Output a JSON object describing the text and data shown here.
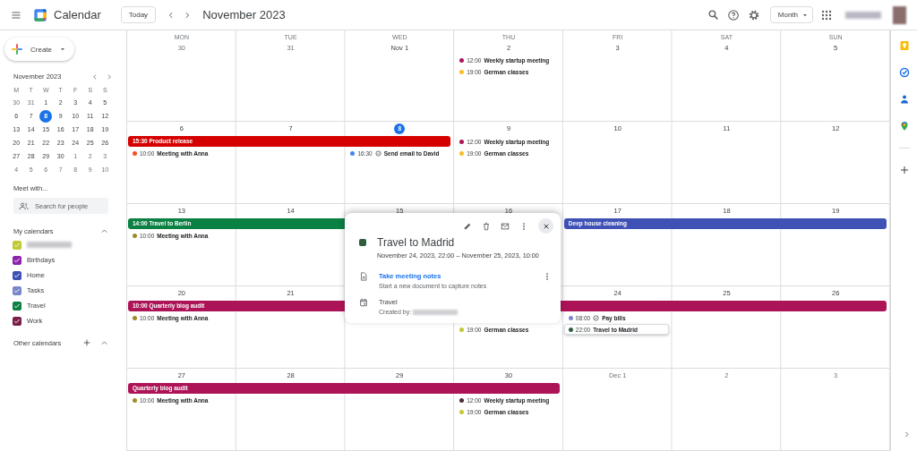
{
  "header": {
    "app_name": "Calendar",
    "today": "Today",
    "period": "November 2023",
    "view": "Month"
  },
  "sidebar": {
    "create": "Create",
    "mini_calendar": {
      "title": "November 2023",
      "weekdays": [
        "M",
        "T",
        "W",
        "T",
        "F",
        "S",
        "S"
      ],
      "weeks": [
        [
          {
            "day": "30",
            "in_month": false,
            "selected": false
          },
          {
            "day": "31",
            "in_month": false,
            "selected": false
          },
          {
            "day": "1",
            "in_month": true,
            "selected": false
          },
          {
            "day": "2",
            "in_month": true,
            "selected": false
          },
          {
            "day": "3",
            "in_month": true,
            "selected": false
          },
          {
            "day": "4",
            "in_month": true,
            "selected": false
          },
          {
            "day": "5",
            "in_month": true,
            "selected": false
          }
        ],
        [
          {
            "day": "6",
            "in_month": true,
            "selected": false
          },
          {
            "day": "7",
            "in_month": true,
            "selected": false
          },
          {
            "day": "8",
            "in_month": true,
            "selected": true
          },
          {
            "day": "9",
            "in_month": true,
            "selected": false
          },
          {
            "day": "10",
            "in_month": true,
            "selected": false
          },
          {
            "day": "11",
            "in_month": true,
            "selected": false
          },
          {
            "day": "12",
            "in_month": true,
            "selected": false
          }
        ],
        [
          {
            "day": "13",
            "in_month": true,
            "selected": false
          },
          {
            "day": "14",
            "in_month": true,
            "selected": false
          },
          {
            "day": "15",
            "in_month": true,
            "selected": false
          },
          {
            "day": "16",
            "in_month": true,
            "selected": false
          },
          {
            "day": "17",
            "in_month": true,
            "selected": false
          },
          {
            "day": "18",
            "in_month": true,
            "selected": false
          },
          {
            "day": "19",
            "in_month": true,
            "selected": false
          }
        ],
        [
          {
            "day": "20",
            "in_month": true,
            "selected": false
          },
          {
            "day": "21",
            "in_month": true,
            "selected": false
          },
          {
            "day": "22",
            "in_month": true,
            "selected": false
          },
          {
            "day": "23",
            "in_month": true,
            "selected": false
          },
          {
            "day": "24",
            "in_month": true,
            "selected": false
          },
          {
            "day": "25",
            "in_month": true,
            "selected": false
          },
          {
            "day": "26",
            "in_month": true,
            "selected": false
          }
        ],
        [
          {
            "day": "27",
            "in_month": true,
            "selected": false
          },
          {
            "day": "28",
            "in_month": true,
            "selected": false
          },
          {
            "day": "29",
            "in_month": true,
            "selected": false
          },
          {
            "day": "30",
            "in_month": true,
            "selected": false
          },
          {
            "day": "1",
            "in_month": false,
            "selected": false
          },
          {
            "day": "2",
            "in_month": false,
            "selected": false
          },
          {
            "day": "3",
            "in_month": false,
            "selected": false
          }
        ],
        [
          {
            "day": "4",
            "in_month": false,
            "selected": false
          },
          {
            "day": "5",
            "in_month": false,
            "selected": false
          },
          {
            "day": "6",
            "in_month": false,
            "selected": false
          },
          {
            "day": "7",
            "in_month": false,
            "selected": false
          },
          {
            "day": "8",
            "in_month": false,
            "selected": false
          },
          {
            "day": "9",
            "in_month": false,
            "selected": false
          },
          {
            "day": "10",
            "in_month": false,
            "selected": false
          }
        ]
      ]
    },
    "meet_with": "Meet with...",
    "search": {
      "placeholder": "Search for people"
    },
    "my_calendars": {
      "title": "My calendars",
      "expanded": true,
      "items": [
        {
          "checked": true,
          "color": "#c0ca33"
        },
        {
          "label": "Birthdays",
          "checked": true,
          "color": "#8e24aa"
        },
        {
          "label": "Home",
          "checked": true,
          "color": "#3f51b5"
        },
        {
          "label": "Tasks",
          "checked": true,
          "color": "#7986cb"
        },
        {
          "label": "Travel",
          "checked": true,
          "color": "#0b8043"
        },
        {
          "label": "Work",
          "checked": true,
          "color": "#7a1e4a"
        }
      ]
    },
    "other_calendars": {
      "title": "Other calendars",
      "expanded": true
    }
  },
  "month": {
    "weekdays": [
      "MON",
      "TUE",
      "WED",
      "THU",
      "FRI",
      "SAT",
      "SUN"
    ],
    "weeks": [
      {
        "days": [
          {
            "label": "30",
            "in_month": false,
            "today": false
          },
          {
            "label": "31",
            "in_month": false,
            "today": false
          },
          {
            "label": "Nov 1",
            "in_month": true,
            "today": false
          },
          {
            "label": "2",
            "in_month": true,
            "today": false,
            "events": [
              {
                "kind": "event",
                "time": "12:00",
                "title": "Weekly startup meeting",
                "color": "#ad1457",
                "selected": false
              },
              {
                "kind": "event",
                "time": "19:00",
                "title": "German classes",
                "color": "#f6bf26",
                "selected": false
              }
            ]
          },
          {
            "label": "3",
            "in_month": true,
            "today": false
          },
          {
            "label": "4",
            "in_month": true,
            "today": false
          },
          {
            "label": "5",
            "in_month": true,
            "today": false
          }
        ]
      },
      {
        "days": [
          {
            "label": "6",
            "in_month": true,
            "today": false,
            "bar": {
              "time": "15:30",
              "title": "Product release",
              "color": "#d50000"
            },
            "events": [
              {
                "kind": "event",
                "time": "10:00",
                "title": "Meeting with Anna",
                "color": "#f4511e",
                "selected": false
              }
            ]
          },
          {
            "label": "7",
            "in_month": true,
            "today": false
          },
          {
            "label": "8",
            "in_month": true,
            "today": true,
            "bar_ends": true,
            "events": [
              {
                "kind": "task",
                "time": "16:30",
                "title": "Send email to David",
                "color": "#4285f4",
                "selected": false
              }
            ]
          },
          {
            "label": "9",
            "in_month": true,
            "today": false,
            "events": [
              {
                "kind": "event",
                "time": "12:00",
                "title": "Weekly startup meeting",
                "color": "#ad1457",
                "selected": false
              },
              {
                "kind": "event",
                "time": "19:00",
                "title": "German classes",
                "color": "#f6bf26",
                "selected": false
              }
            ]
          },
          {
            "label": "10",
            "in_month": true,
            "today": false
          },
          {
            "label": "11",
            "in_month": true,
            "today": false
          },
          {
            "label": "12",
            "in_month": true,
            "today": false
          }
        ]
      },
      {
        "days": [
          {
            "label": "13",
            "in_month": true,
            "today": false,
            "bar": {
              "time": "14:00",
              "title": "Travel to Berlin",
              "color": "#0b8043"
            },
            "events": [
              {
                "kind": "event",
                "time": "10:00",
                "title": "Meeting with Anna",
                "color": "#9e8a28",
                "selected": false
              }
            ]
          },
          {
            "label": "14",
            "in_month": true,
            "today": false
          },
          {
            "label": "15",
            "in_month": true,
            "today": false,
            "bar_ends": true
          },
          {
            "label": "16",
            "in_month": true,
            "today": false
          },
          {
            "label": "17",
            "in_month": true,
            "today": false,
            "bar": {
              "title": "Deep house cleaning",
              "color": "#3f51b5"
            }
          },
          {
            "label": "18",
            "in_month": true,
            "today": false
          },
          {
            "label": "19",
            "in_month": true,
            "today": false,
            "bar_ends": true
          }
        ]
      },
      {
        "days": [
          {
            "label": "20",
            "in_month": true,
            "today": false,
            "bar": {
              "time": "10:00",
              "title": "Quarterly blog audit",
              "color": "#ad1457"
            },
            "events": [
              {
                "kind": "event",
                "time": "10:00",
                "title": "Meeting with Anna",
                "color": "#9e8a28",
                "selected": false
              }
            ]
          },
          {
            "label": "21",
            "in_month": true,
            "today": false
          },
          {
            "covered": true
          },
          {
            "covered": true,
            "events": [
              {
                "kind": "event",
                "time": "19:00",
                "title": "German classes",
                "color": "#c0ca33",
                "selected": false
              }
            ]
          },
          {
            "label": "24",
            "in_month": true,
            "today": false,
            "events": [
              {
                "kind": "task",
                "time": "08:00",
                "title": "Pay bills",
                "color": "#7986cb",
                "selected": false
              },
              {
                "kind": "event",
                "time": "22:00",
                "title": "Travel to Madrid",
                "color": "#2e5e3e",
                "selected": true
              }
            ]
          },
          {
            "label": "25",
            "in_month": true,
            "today": false
          },
          {
            "label": "26",
            "in_month": true,
            "today": false,
            "bar_ends": true
          }
        ]
      },
      {
        "days": [
          {
            "label": "27",
            "in_month": true,
            "today": false,
            "bar": {
              "title": "Quarterly blog audit",
              "color": "#ad1457"
            },
            "events": [
              {
                "kind": "event",
                "time": "10:00",
                "title": "Meeting with Anna",
                "color": "#9e8a28",
                "selected": false
              }
            ]
          },
          {
            "label": "28",
            "in_month": true,
            "today": false
          },
          {
            "label": "29",
            "in_month": true,
            "today": false
          },
          {
            "label": "30",
            "in_month": true,
            "today": false,
            "bar_ends": true,
            "events": [
              {
                "kind": "event",
                "time": "12:00",
                "title": "Weekly startup meeting",
                "color": "#4a2c3a",
                "selected": false
              },
              {
                "kind": "event",
                "time": "19:00",
                "title": "German classes",
                "color": "#c0ca33",
                "selected": false
              }
            ]
          },
          {
            "label": "Dec 1",
            "in_month": false,
            "today": false
          },
          {
            "label": "2",
            "in_month": false,
            "today": false
          },
          {
            "label": "3",
            "in_month": false,
            "today": false
          }
        ]
      }
    ]
  },
  "popup": {
    "color": "#2e5e3e",
    "title": "Travel to Madrid",
    "when": "November 24, 2023, 22:00 – November 25, 2023, 10:00",
    "notes_link": "Take meeting notes",
    "notes_hint": "Start a new document to capture notes",
    "calendar": "Travel",
    "created_by": "Created by:"
  }
}
